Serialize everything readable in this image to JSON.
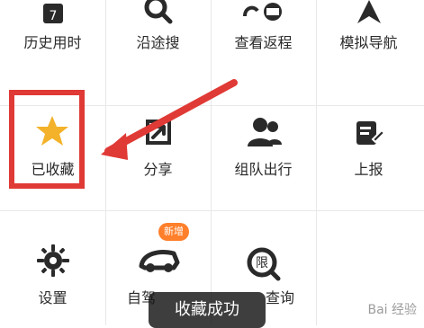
{
  "grid": [
    {
      "key": "history",
      "label": "历史用时",
      "icon": "calendar-7-icon"
    },
    {
      "key": "along",
      "label": "沿途搜",
      "icon": "search-icon"
    },
    {
      "key": "return",
      "label": "查看返程",
      "icon": "return-route-icon"
    },
    {
      "key": "simulate",
      "label": "模拟导航",
      "icon": "navigation-arrow-icon"
    },
    {
      "key": "favorite",
      "label": "已收藏",
      "icon": "star-icon"
    },
    {
      "key": "share",
      "label": "分享",
      "icon": "share-icon"
    },
    {
      "key": "team",
      "label": "组队出行",
      "icon": "team-icon"
    },
    {
      "key": "report",
      "label": "上报",
      "icon": "edit-report-icon"
    },
    {
      "key": "settings",
      "label": "设置",
      "icon": "gear-icon"
    },
    {
      "key": "drive",
      "label": "自驾",
      "icon": "car-icon"
    },
    {
      "key": "query",
      "label": "查询",
      "icon": "restriction-icon"
    }
  ],
  "badge": {
    "text": "新增"
  },
  "toast": {
    "text": "收藏成功"
  },
  "watermark": {
    "text": "Bai 经验"
  },
  "colors": {
    "accent": "#ff7f2a",
    "highlight": "#e03a36",
    "star": "#f3b229"
  }
}
